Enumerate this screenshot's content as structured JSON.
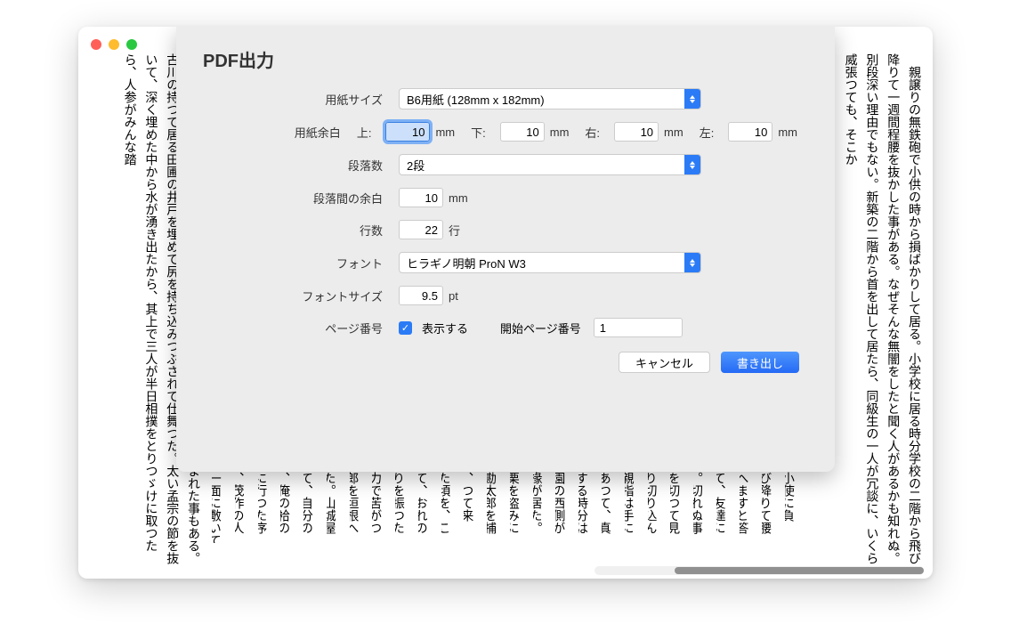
{
  "dialog": {
    "title": "PDF出力",
    "labels": {
      "paper_size": "用紙サイズ",
      "margins": "用紙余白",
      "columns": "段落数",
      "col_gap": "段落間の余白",
      "lines": "行数",
      "font": "フォント",
      "font_size": "フォントサイズ",
      "page_number": "ページ番号"
    },
    "margin_labels": {
      "top": "上:",
      "bottom": "下:",
      "right": "右:",
      "left": "左:"
    },
    "values": {
      "paper_size": "B6用紙 (128mm x 182mm)",
      "margin_top": "10",
      "margin_bottom": "10",
      "margin_right": "10",
      "margin_left": "10",
      "columns": "2段",
      "col_gap": "10",
      "lines": "22",
      "font": "ヒラギノ明朝 ProN W3",
      "font_size": "9.5",
      "show_pagenum_label": "表示する",
      "start_page_label": "開始ページ番号",
      "start_page": "1"
    },
    "units": {
      "mm": "mm",
      "lines": "行",
      "pt": "pt"
    },
    "buttons": {
      "cancel": "キャンセル",
      "export": "書き出し"
    }
  },
  "background_text": {
    "right": "　親譲りの無鉄砲で小供の時から損ばかりして居る。小学校に居る時分学校の二階から飛び降りて一週間程腰を抜かした事がある。なぜそんな無闇をしたと聞く人があるかも知れぬ。別段深い理由でもない。新築の二階から首を出して居たら、同級生の一人が冗談に、いくら威張つても、そこか",
    "left": "て、そこいらの稲に水がかゝる仕掛であつた。其時分はどんな仕掛かしらまれた事もある。古川の持つて居る田圃の井戸を埋めて尻を持ち込みつぶされて仕舞つた。太い孟宗の節を抜いて、深く埋めた中から水が湧き出たから、其上で三人が半日相撲をとりつゞけに取つたら、人参がみんな踏",
    "snippets": [
      "小使に負",
      "び降りて腰",
      "へますと答",
      "て、友達に",
      "。切れぬ事",
      "を切つて見",
      "り切り込ん",
      "親指は手に",
      "あつて、真",
      "する時分は",
      "園の西側が",
      "椽が居た。",
      "栗を盗みに",
      "勘太郎を捕",
      "、つて来",
      "た頃を、こ",
      "て、おれの",
      "りを振つた",
      "力で苦がつ",
      "郎を垣根へ",
      "た。山城屋",
      "て、自分の",
      "、俺の袷の",
      "に行つた序",
      "、茂作の人",
      "一面に敷いてあつ"
    ]
  }
}
